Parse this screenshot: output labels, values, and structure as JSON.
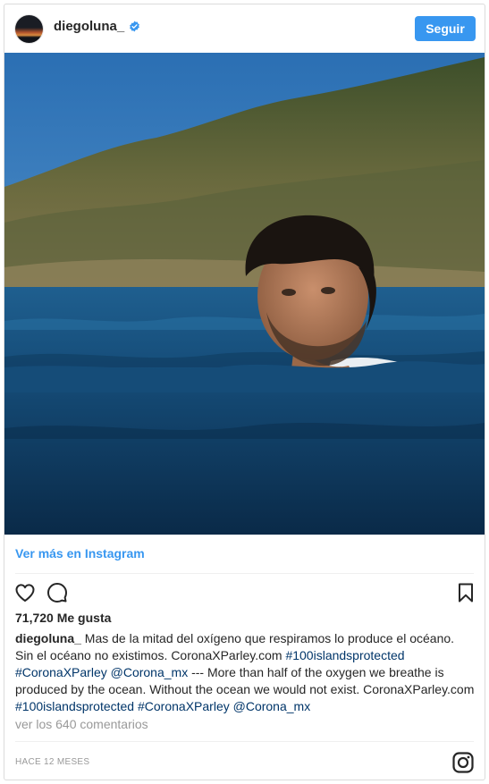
{
  "post": {
    "username": "diegoluna_",
    "verified": true,
    "follow_label": "Seguir",
    "photo_alt": "diegoluna_",
    "view_more_label": "Ver más en Instagram",
    "likes_text": "71,720 Me gusta",
    "caption": {
      "author": "diegoluna_",
      "segments": [
        {
          "text": " Mas de la mitad del oxígeno que respiramos lo produce el océano. Sin el océano no existimos. CoronaXParley.com ",
          "type": "text"
        },
        {
          "text": "#100islandsprotected",
          "type": "tag"
        },
        {
          "text": " ",
          "type": "text"
        },
        {
          "text": "#CoronaXParley",
          "type": "tag"
        },
        {
          "text": " ",
          "type": "text"
        },
        {
          "text": "@Corona_mx",
          "type": "tag"
        },
        {
          "text": " --- More than half of the oxygen we breathe is produced by the ocean. Without the ocean we would not exist. CoronaXParley.com ",
          "type": "text"
        },
        {
          "text": "#100islandsprotected",
          "type": "tag"
        },
        {
          "text": " ",
          "type": "text"
        },
        {
          "text": "#CoronaXParley",
          "type": "tag"
        },
        {
          "text": " ",
          "type": "text"
        },
        {
          "text": "@Corona_mx",
          "type": "tag"
        }
      ]
    },
    "comments_link": "ver los 640 comentarios",
    "timestamp": "HACE 12 MESES"
  },
  "icons": {
    "like": "heart-icon",
    "comment": "comment-icon",
    "save": "bookmark-icon",
    "brand": "instagram-logo-icon",
    "verified": "verified-badge-icon"
  },
  "colors": {
    "accent": "#3897f0",
    "hashtag": "#003569",
    "muted": "#999999",
    "text": "#262626",
    "border": "#dbdbdb"
  }
}
